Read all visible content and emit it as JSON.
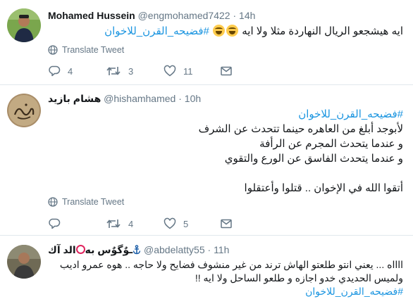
{
  "tweets": [
    {
      "author_name": "Mohamed Hussein",
      "author_handle": "@engmohamed7422",
      "time": "14h",
      "text_before_emoji": "ايه هيشجعو الريال النهاردة مثلا ولا ايه",
      "hashtag": "#فضيحه_القرن_للاخوان",
      "emoji_count": 2,
      "translate_label": "Translate Tweet",
      "replies": "4",
      "retweets": "3",
      "likes": "11"
    },
    {
      "author_name": "هشام بازيد",
      "author_handle": "@hishamhamed",
      "time": "10h",
      "hashtag": "#فضيحه_القرن_للاخوان",
      "lines": [
        "لأبوجد أبلغ من العاهره حينما تتحدث عن الشرف",
        "و عندما يتحدث المجرم عن الرأفة",
        "و عندما يتحدث الفاسق عن الورع والتقوي",
        "أتقوا الله في الإخوان .. قتلوا وأعتقلوا"
      ],
      "translate_label": "Translate Tweet",
      "replies": "",
      "retweets": "4",
      "likes": "5"
    },
    {
      "author_name_part1": "الد آك",
      "author_name_part2": "ـوٌگوٌس به",
      "author_handle": "@abdelatty55",
      "time": "11h",
      "lines": [
        "ااااه ... يعني انتو طلعتو الهاش ترند من غير منشوف فضايح ولا حاجه .. هوه عمرو اديب",
        "ولميس الحديدي خدو اجازه و طلعو الساحل ولا ايه !!"
      ],
      "hashtag_partial": "#فضيحه_القرن_للاخوان"
    }
  ],
  "colors": {
    "hashtag": "#1b95e0",
    "meta": "#657786",
    "divider": "#e1e8ed",
    "text": "#14171a"
  },
  "icons": [
    "reply-icon",
    "retweet-icon",
    "like-icon",
    "direct-message-icon",
    "globe-icon",
    "anchor-icon",
    "face-with-tears-of-joy-emoji"
  ]
}
